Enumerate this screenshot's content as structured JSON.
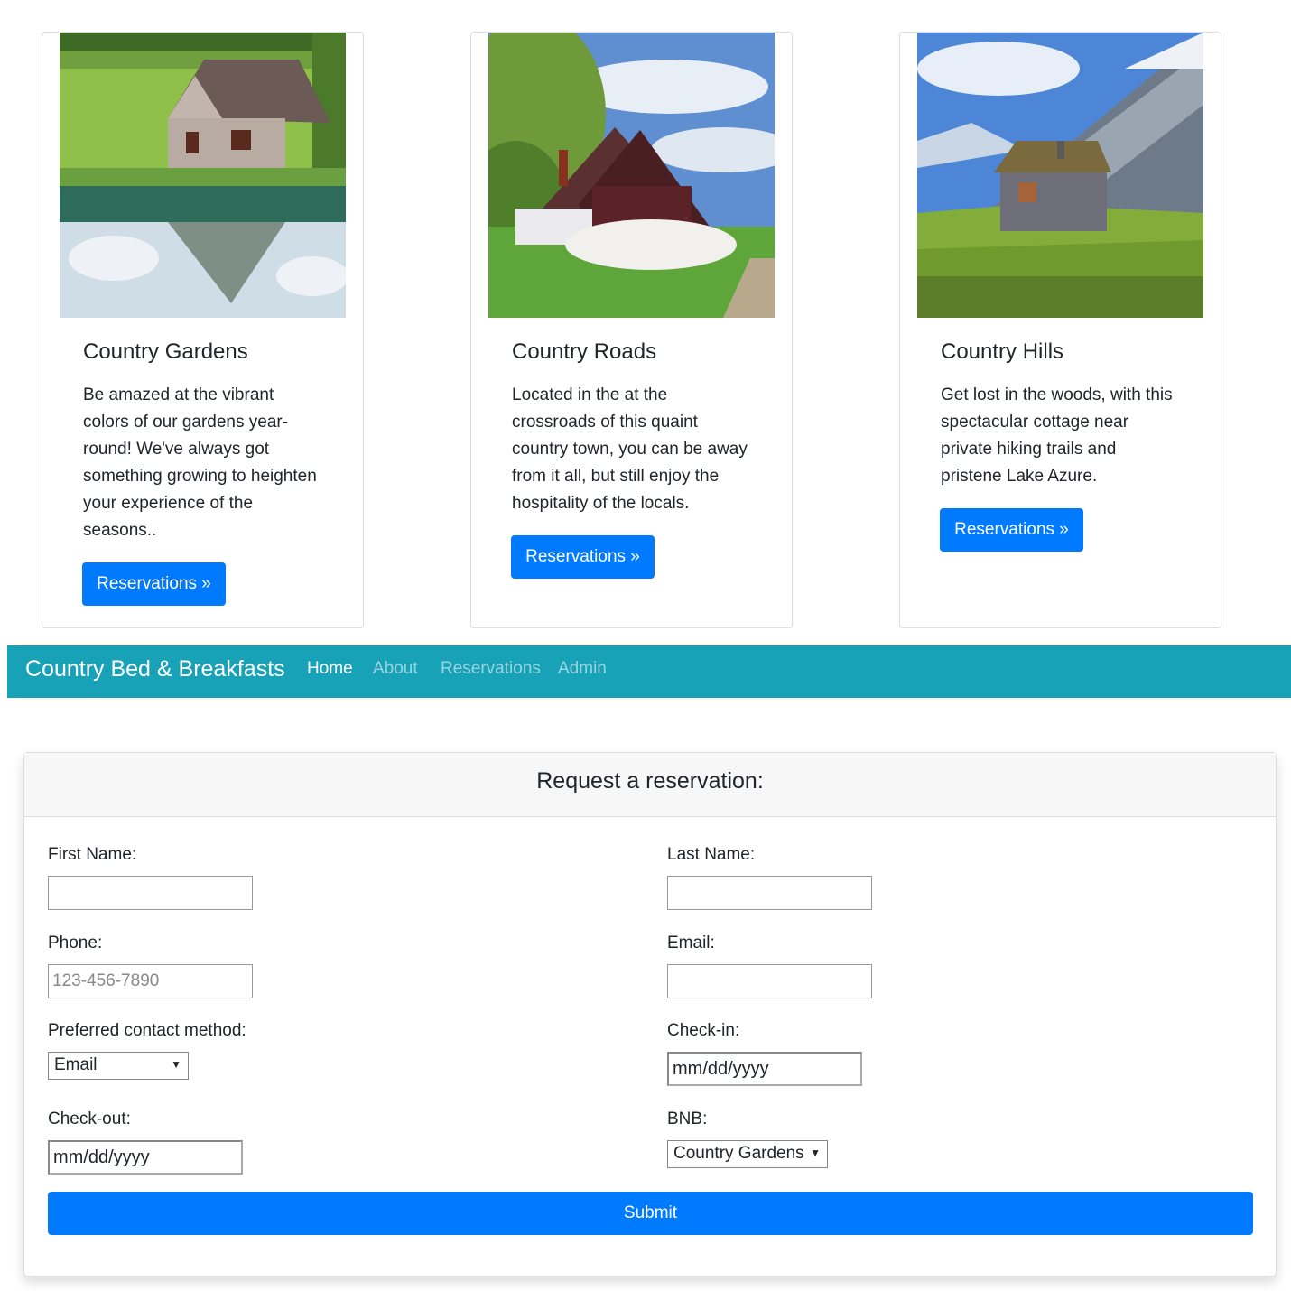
{
  "cards": [
    {
      "title": "Country Gardens",
      "text": "Be amazed at the vibrant colors of our gardens year-round! We've always got something growing to heighten your experience of the seasons..",
      "button": "Reservations »"
    },
    {
      "title": "Country Roads",
      "text": "Located in the at the crossroads of this quaint country town, you can be away from it all, but still enjoy the hospitality of the locals.",
      "button": "Reservations »"
    },
    {
      "title": "Country Hills",
      "text": "Get lost in the woods, with this spectacular cottage near private hiking trails and pristene Lake Azure.",
      "button": "Reservations »"
    }
  ],
  "navbar": {
    "brand": "Country Bed & Breakfasts",
    "links": [
      "Home",
      "About",
      "Reservations",
      "Admin"
    ],
    "active": "Home",
    "color": "#17a2b8"
  },
  "form": {
    "title": "Request a reservation:",
    "first_name_label": "First Name:",
    "last_name_label": "Last Name:",
    "phone_label": "Phone:",
    "phone_placeholder": "123-456-7890",
    "email_label": "Email:",
    "contact_label": "Preferred contact method:",
    "contact_value": "Email",
    "checkin_label": "Check-in:",
    "checkin_value": "mm/dd/yyyy",
    "checkout_label": "Check-out:",
    "checkout_value": "mm/dd/yyyy",
    "bnb_label": "BNB:",
    "bnb_value": "Country Gardens",
    "submit": "Submit"
  },
  "accent_color": "#007bff"
}
